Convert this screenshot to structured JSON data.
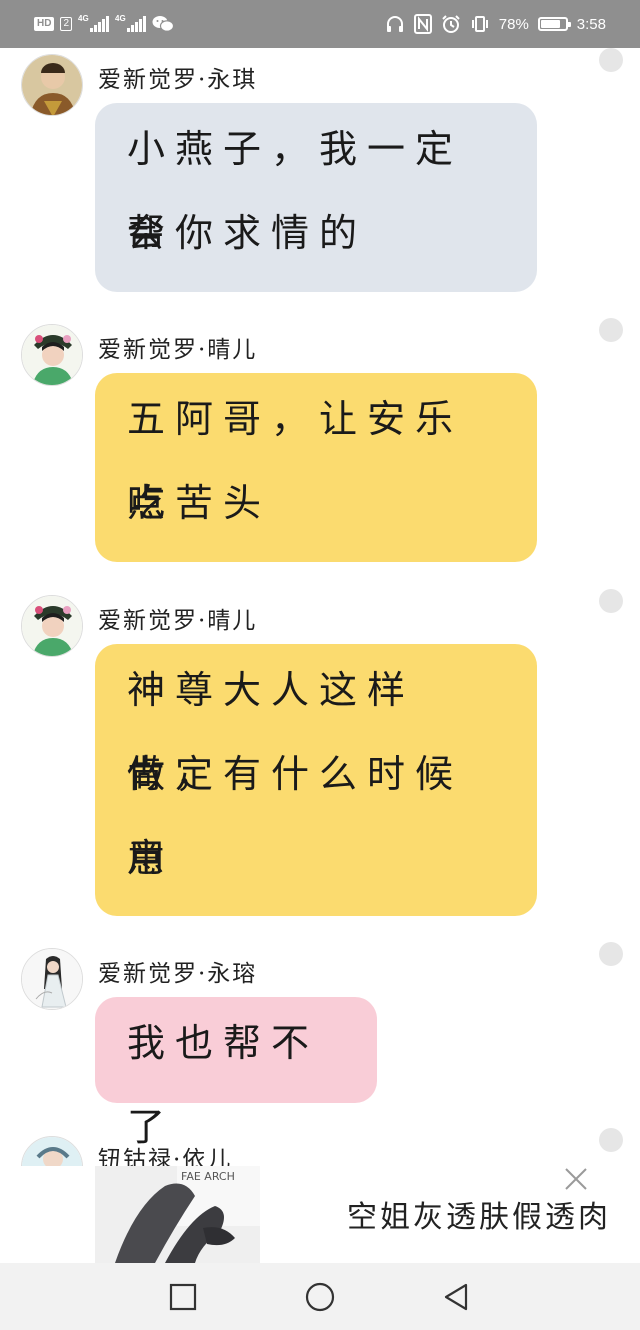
{
  "status_bar": {
    "left_badge": "HD",
    "sim1": "2",
    "net1": "4G",
    "net2": "4G",
    "battery_text": "78%",
    "battery_level": 0.78,
    "time": "3:58",
    "icons": [
      "headphones-icon",
      "nfc-icon",
      "alarm-icon",
      "vibrate-icon",
      "battery-icon",
      "wechat-icon"
    ]
  },
  "messages": [
    {
      "sender": "爱新觉罗·永琪",
      "lines": [
        "小燕子，我一定会",
        "帮你求情的"
      ],
      "bubble_color": "#e0e5ec"
    },
    {
      "sender": "爱新觉罗·晴儿",
      "lines": [
        "五阿哥，让安乐吃",
        "点苦头"
      ],
      "bubble_color": "#fbdb6f"
    },
    {
      "sender": "爱新觉罗·晴儿",
      "lines": [
        "神尊大人这样做，",
        "肯定有什么时候用",
        "意"
      ],
      "bubble_color": "#fbdb6f"
    },
    {
      "sender": "爱新觉罗·永瑢",
      "lines": [
        "我也帮不了"
      ],
      "bubble_color": "#f9cdd7"
    },
    {
      "sender": "钮钴禄·依儿",
      "lines": [],
      "bubble_color": ""
    }
  ],
  "ad": {
    "title": "空姐灰透肤假透肉",
    "image_text": "FAE ARCH"
  },
  "nav": {
    "buttons": [
      "recent-apps-button",
      "home-button",
      "back-button"
    ]
  }
}
